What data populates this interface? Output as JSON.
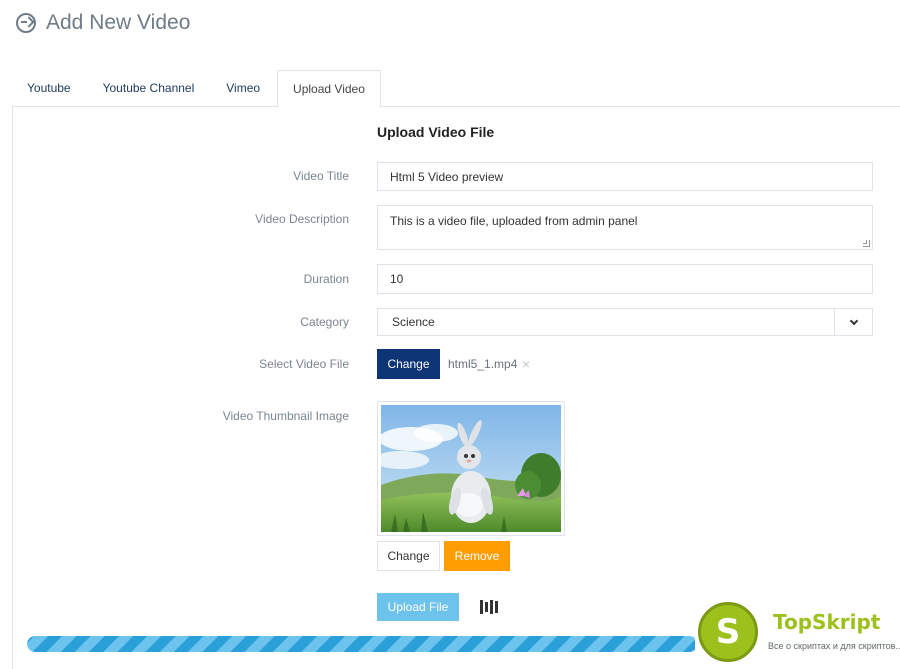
{
  "header": {
    "title": "Add New Video",
    "icon": "circle-arrow-right-icon"
  },
  "tabs": [
    {
      "label": "Youtube",
      "active": false
    },
    {
      "label": "Youtube Channel",
      "active": false
    },
    {
      "label": "Vimeo",
      "active": false
    },
    {
      "label": "Upload Video",
      "active": true
    }
  ],
  "form": {
    "section_title": "Upload Video File",
    "video_title": {
      "label": "Video Title",
      "value": "Html 5 Video preview"
    },
    "video_description": {
      "label": "Video Description",
      "value": "This is a video file, uploaded from admin panel"
    },
    "duration": {
      "label": "Duration",
      "value": "10"
    },
    "category": {
      "label": "Category",
      "value": "Science"
    },
    "video_file": {
      "label": "Select Video File",
      "button": "Change",
      "file_name": "html5_1.mp4",
      "remove_symbol": "×"
    },
    "thumbnail": {
      "label": "Video Thumbnail Image",
      "change_button": "Change",
      "remove_button": "Remove"
    },
    "upload_button": "Upload File"
  },
  "progress": {
    "value": 0.77
  },
  "watermark": {
    "letter": "S",
    "brand": "TopSkript",
    "tagline": "Все о скриптах и для скриптов..."
  },
  "colors": {
    "primary": "#0d3474",
    "warning": "#ff9c00",
    "info": "#6dc3ec",
    "progress": "#2a9fd8"
  }
}
